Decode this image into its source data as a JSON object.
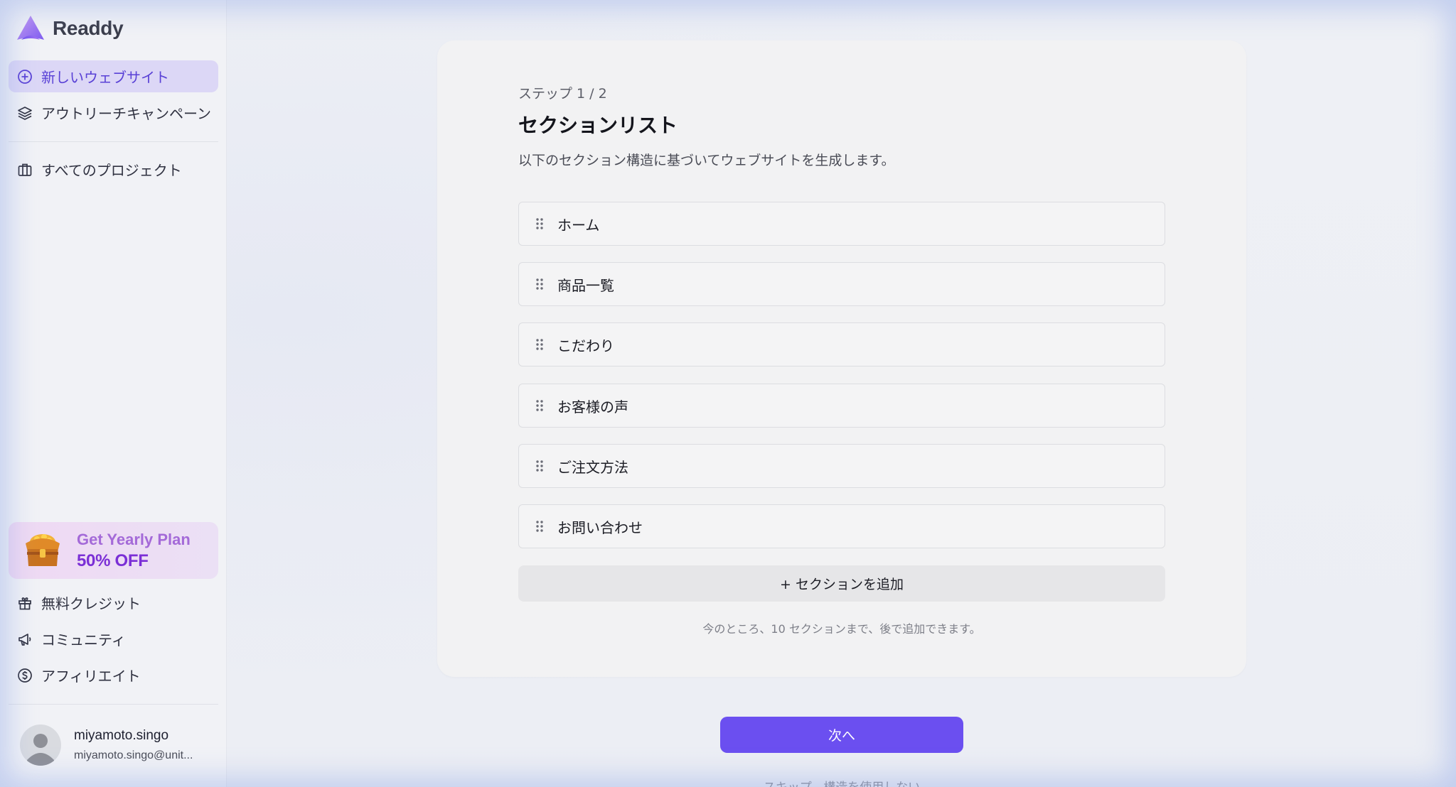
{
  "app": {
    "name": "Readdy"
  },
  "sidebar": {
    "items": [
      {
        "label": "新しいウェブサイト",
        "icon": "plus-circle-icon",
        "active": true
      },
      {
        "label": "アウトリーチキャンペーン",
        "icon": "layers-icon"
      },
      {
        "label": "すべてのプロジェクト",
        "icon": "briefcase-icon"
      }
    ],
    "promo": {
      "line1": "Get Yearly Plan",
      "line2": "50% OFF",
      "icon": "treasure-chest-icon"
    },
    "bottom_items": [
      {
        "label": "無料クレジット",
        "icon": "gift-icon"
      },
      {
        "label": "コミュニティ",
        "icon": "megaphone-icon"
      },
      {
        "label": "アフィリエイト",
        "icon": "dollar-circle-icon"
      }
    ],
    "user": {
      "name": "miyamoto.singo",
      "email": "miyamoto.singo@unit..."
    }
  },
  "main": {
    "step": "ステップ 1 / 2",
    "title": "セクションリスト",
    "subtitle": "以下のセクション構造に基づいてウェブサイトを生成します。",
    "sections": [
      {
        "label": "ホーム"
      },
      {
        "label": "商品一覧"
      },
      {
        "label": "こだわり"
      },
      {
        "label": "お客様の声"
      },
      {
        "label": "ご注文方法"
      },
      {
        "label": "お問い合わせ"
      }
    ],
    "add_button": "+ セクションを追加",
    "note": "今のところ、10 セクションまで、後で追加できます。",
    "next_button": "次へ",
    "skip_link": "スキップ、構造を使用しない"
  },
  "colors": {
    "accent": "#6b4ff0",
    "active_nav_bg": "#dcd7f6",
    "active_nav_text": "#5941d6",
    "promo_text": "#7b2fd6"
  }
}
